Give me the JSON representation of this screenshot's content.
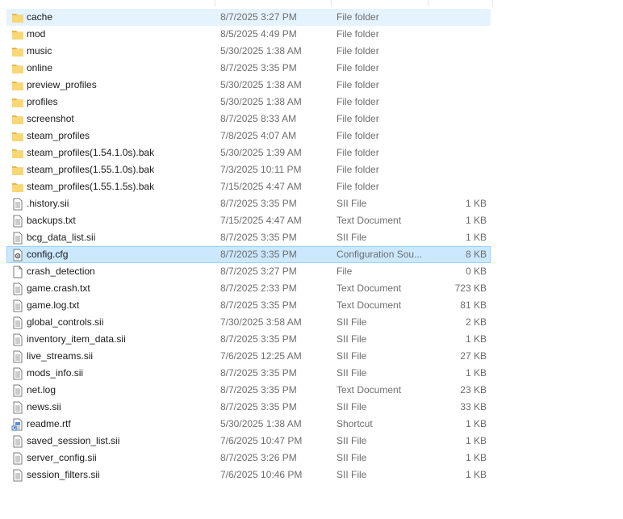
{
  "files": [
    {
      "name": "cache",
      "date": "8/7/2025 3:27 PM",
      "type": "File folder",
      "size": "",
      "icon": "folder-icon",
      "state": "hover"
    },
    {
      "name": "mod",
      "date": "8/5/2025 4:49 PM",
      "type": "File folder",
      "size": "",
      "icon": "folder-icon"
    },
    {
      "name": "music",
      "date": "5/30/2025 1:38 AM",
      "type": "File folder",
      "size": "",
      "icon": "folder-icon"
    },
    {
      "name": "online",
      "date": "8/7/2025 3:35 PM",
      "type": "File folder",
      "size": "",
      "icon": "folder-icon"
    },
    {
      "name": "preview_profiles",
      "date": "5/30/2025 1:38 AM",
      "type": "File folder",
      "size": "",
      "icon": "folder-icon"
    },
    {
      "name": "profiles",
      "date": "5/30/2025 1:38 AM",
      "type": "File folder",
      "size": "",
      "icon": "folder-icon"
    },
    {
      "name": "screenshot",
      "date": "8/7/2025 8:33 AM",
      "type": "File folder",
      "size": "",
      "icon": "folder-icon"
    },
    {
      "name": "steam_profiles",
      "date": "7/8/2025 4:07 AM",
      "type": "File folder",
      "size": "",
      "icon": "folder-icon"
    },
    {
      "name": "steam_profiles(1.54.1.0s).bak",
      "date": "5/30/2025 1:39 AM",
      "type": "File folder",
      "size": "",
      "icon": "folder-icon"
    },
    {
      "name": "steam_profiles(1.55.1.0s).bak",
      "date": "7/3/2025 10:11 PM",
      "type": "File folder",
      "size": "",
      "icon": "folder-icon"
    },
    {
      "name": "steam_profiles(1.55.1.5s).bak",
      "date": "7/15/2025 4:47 AM",
      "type": "File folder",
      "size": "",
      "icon": "folder-icon"
    },
    {
      "name": ".history.sii",
      "date": "8/7/2025 3:35 PM",
      "type": "SII File",
      "size": "1 KB",
      "icon": "text-file-icon"
    },
    {
      "name": "backups.txt",
      "date": "7/15/2025 4:47 AM",
      "type": "Text Document",
      "size": "1 KB",
      "icon": "text-file-icon"
    },
    {
      "name": "bcg_data_list.sii",
      "date": "8/7/2025 3:35 PM",
      "type": "SII File",
      "size": "1 KB",
      "icon": "text-file-icon"
    },
    {
      "name": "config.cfg",
      "date": "8/7/2025 3:35 PM",
      "type": "Configuration Sou...",
      "size": "8 KB",
      "icon": "config-file-icon",
      "state": "selected"
    },
    {
      "name": "crash_detection",
      "date": "8/7/2025 3:27 PM",
      "type": "File",
      "size": "0 KB",
      "icon": "blank-file-icon"
    },
    {
      "name": "game.crash.txt",
      "date": "8/7/2025 2:33 PM",
      "type": "Text Document",
      "size": "723 KB",
      "icon": "text-file-icon"
    },
    {
      "name": "game.log.txt",
      "date": "8/7/2025 3:35 PM",
      "type": "Text Document",
      "size": "81 KB",
      "icon": "text-file-icon"
    },
    {
      "name": "global_controls.sii",
      "date": "7/30/2025 3:58 AM",
      "type": "SII File",
      "size": "2 KB",
      "icon": "text-file-icon"
    },
    {
      "name": "inventory_item_data.sii",
      "date": "8/7/2025 3:35 PM",
      "type": "SII File",
      "size": "1 KB",
      "icon": "text-file-icon"
    },
    {
      "name": "live_streams.sii",
      "date": "7/6/2025 12:25 AM",
      "type": "SII File",
      "size": "27 KB",
      "icon": "text-file-icon"
    },
    {
      "name": "mods_info.sii",
      "date": "8/7/2025 3:35 PM",
      "type": "SII File",
      "size": "1 KB",
      "icon": "text-file-icon"
    },
    {
      "name": "net.log",
      "date": "8/7/2025 3:35 PM",
      "type": "Text Document",
      "size": "23 KB",
      "icon": "text-file-icon"
    },
    {
      "name": "news.sii",
      "date": "8/7/2025 3:35 PM",
      "type": "SII File",
      "size": "33 KB",
      "icon": "text-file-icon"
    },
    {
      "name": "readme.rtf",
      "date": "5/30/2025 1:38 AM",
      "type": "Shortcut",
      "size": "1 KB",
      "icon": "shortcut-icon"
    },
    {
      "name": "saved_session_list.sii",
      "date": "7/6/2025 10:47 PM",
      "type": "SII File",
      "size": "1 KB",
      "icon": "text-file-icon"
    },
    {
      "name": "server_config.sii",
      "date": "8/7/2025 3:26 PM",
      "type": "SII File",
      "size": "1 KB",
      "icon": "text-file-icon"
    },
    {
      "name": "session_filters.sii",
      "date": "7/6/2025 10:46 PM",
      "type": "SII File",
      "size": "1 KB",
      "icon": "text-file-icon"
    }
  ],
  "colors": {
    "folder": "#f8d775",
    "folder_dark": "#e6b84a",
    "selection_bg": "#cce8ff",
    "selection_border": "#99d1ff",
    "hover_bg": "#e5f3ff",
    "secondary_text": "#6d6d6d"
  }
}
